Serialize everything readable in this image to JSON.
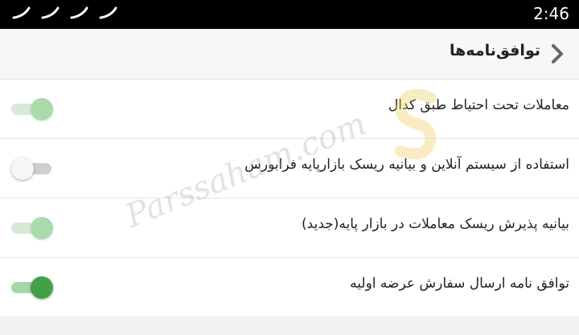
{
  "status_bar": {
    "time": "2:46",
    "notification_icons": [
      "notification-icon",
      "notification-icon",
      "notification-icon",
      "notification-icon"
    ]
  },
  "header": {
    "title": "توافق‌نامه‌ها",
    "back_icon": "chevron-right-icon"
  },
  "agreements": [
    {
      "label": "معاملات تحت احتیاط طبق کدال",
      "toggle_state": "on-disabled"
    },
    {
      "label": "استفاده از سیستم آنلاین و بیانیه ریسک بازارپایه فرابورس",
      "toggle_state": "off"
    },
    {
      "label": "بیانیه پذیرش ریسک معاملات در بازار پایه(جدید)",
      "toggle_state": "on-disabled"
    },
    {
      "label": "توافق نامه ارسال سفارش عرضه اولیه",
      "toggle_state": "on"
    }
  ],
  "watermark": {
    "text": "Parssaham.com"
  },
  "colors": {
    "toggle_on": "#43a047",
    "toggle_on_track": "#a5d6a7",
    "toggle_disabled_thumb": "#a9dbab",
    "toggle_off_thumb": "#f6f6f6",
    "toggle_off_track": "#cfcfcf",
    "status_bar": "#000000",
    "header_bg": "#f7f7f7",
    "page_bg": "#f2f2f4"
  }
}
